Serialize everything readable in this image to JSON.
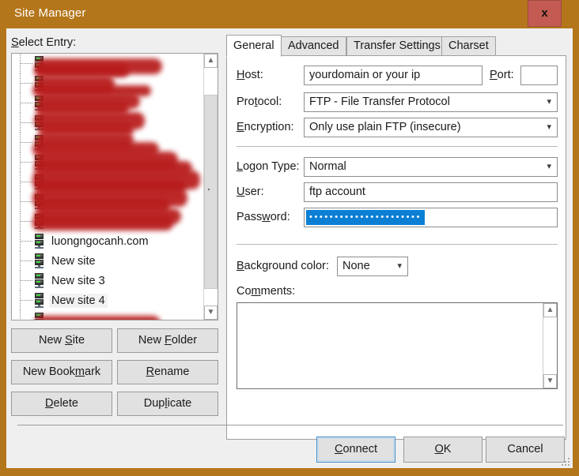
{
  "window": {
    "title": "Site Manager",
    "close_label": "x",
    "accent_color": "#b4761a",
    "close_button_color": "#c45b53",
    "dialog_bg": "#efefef"
  },
  "left_pane": {
    "select_entry_label": "Select Entry:",
    "tree_items": [
      {
        "label": "",
        "redacted": true,
        "selected": false
      },
      {
        "label": "",
        "redacted": true,
        "selected": false
      },
      {
        "label": "",
        "redacted": true,
        "selected": false
      },
      {
        "label": "",
        "redacted": true,
        "selected": false
      },
      {
        "label": "",
        "redacted": true,
        "selected": false
      },
      {
        "label": "",
        "redacted": true,
        "selected": false
      },
      {
        "label": "",
        "redacted": true,
        "selected": false
      },
      {
        "label": "",
        "redacted": true,
        "selected": false
      },
      {
        "label": "",
        "redacted": true,
        "selected": false
      },
      {
        "label": "luongngocanh.com",
        "redacted": true,
        "selected": false
      },
      {
        "label": "New site",
        "redacted": false,
        "selected": false
      },
      {
        "label": "New site 3",
        "redacted": false,
        "selected": false
      },
      {
        "label": "New site 4",
        "redacted": false,
        "selected": true
      },
      {
        "label": "",
        "redacted": true,
        "selected": false
      },
      {
        "label": "",
        "redacted": true,
        "selected": false
      }
    ],
    "buttons": {
      "new_site": {
        "pre": "N",
        "key": "S",
        "post": "ite",
        "full": "New Site"
      },
      "new_folder": {
        "pre": "New ",
        "key": "F",
        "post": "older",
        "full": "New Folder"
      },
      "new_bookmark": {
        "pre": "New Book",
        "key": "m",
        "post": "ark",
        "full": "New Bookmark"
      },
      "rename": {
        "pre": "",
        "key": "R",
        "post": "ename",
        "full": "Rename"
      },
      "delete": {
        "pre": "",
        "key": "D",
        "post": "elete",
        "full": "Delete"
      },
      "duplicate": {
        "pre": "Dup",
        "key": "l",
        "post": "icate",
        "full": "Duplicate"
      }
    }
  },
  "right_pane": {
    "tabs": [
      {
        "label": "General",
        "active": true
      },
      {
        "label": "Advanced",
        "active": false
      },
      {
        "label": "Transfer Settings",
        "active": false
      },
      {
        "label": "Charset",
        "active": false
      }
    ],
    "general": {
      "host_label": "Host:",
      "host_value": "yourdomain or your ip",
      "port_label": "Port:",
      "port_value": "",
      "protocol_label": "Protocol:",
      "protocol_value": "FTP - File Transfer Protocol",
      "encryption_label": "Encryption:",
      "encryption_value": "Only use plain FTP (insecure)",
      "logon_type_label": "Logon Type:",
      "logon_type_value": "Normal",
      "user_label": "User:",
      "user_value": "ftp account",
      "password_label": "Password:",
      "password_masked": "••••••••••••••••••••••",
      "password_selection_color": "#0b7fd4",
      "background_color_label": "Background color:",
      "background_color_value": "None",
      "comments_label": "Comments:",
      "comments_value": ""
    }
  },
  "footer": {
    "connect": {
      "pre": "",
      "key": "C",
      "post": "onnect",
      "full": "Connect"
    },
    "ok": {
      "pre": "",
      "key": "O",
      "post": "K",
      "full": "OK"
    },
    "cancel": {
      "pre": "Cancel",
      "key": "",
      "post": "",
      "full": "Cancel"
    }
  }
}
